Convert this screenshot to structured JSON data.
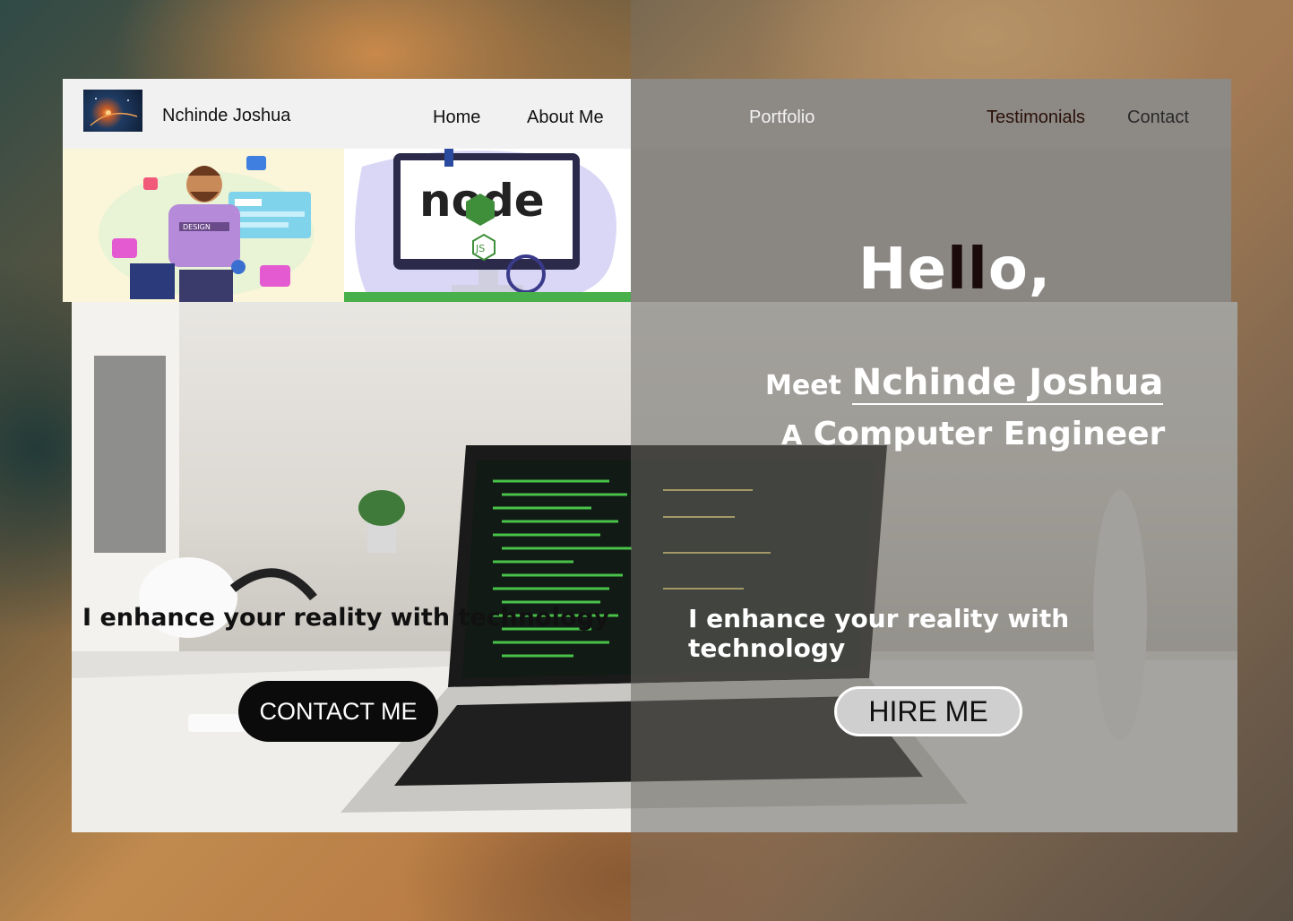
{
  "brand": {
    "name": "Nchinde Joshua",
    "logo_icon": "space-earth-logo"
  },
  "nav": {
    "home": "Home",
    "about": "About Me",
    "portfolio": "Portfolio",
    "testimonials": "Testimonials",
    "contact": "Contact"
  },
  "thumbnails": {
    "design": {
      "badge": "DESIGN",
      "icon": "designer-illustration"
    },
    "node": {
      "logo_text": "node",
      "badge": "JS",
      "icon": "nodejs-illustration"
    }
  },
  "hero": {
    "greeting_a": "He",
    "greeting_b": "ll",
    "greeting_c": "o,",
    "meet_prefix": "Meet",
    "meet_name": "Nchinde Joshua",
    "role_prefix": "A",
    "role": "Computer Engineer",
    "tagline_left": "I enhance your reality with technology",
    "tagline_right": "I enhance your reality with technology",
    "contact_button": "CONTACT ME",
    "hire_button": "HIRE ME"
  },
  "colors": {
    "nav_left_bg": "#f1f1f1",
    "nav_right_bg": "#8d8a86",
    "contact_button_bg": "#0b0b0b",
    "hire_button_bg": "#cfcfcf",
    "node_green": "#3f8f3a"
  }
}
